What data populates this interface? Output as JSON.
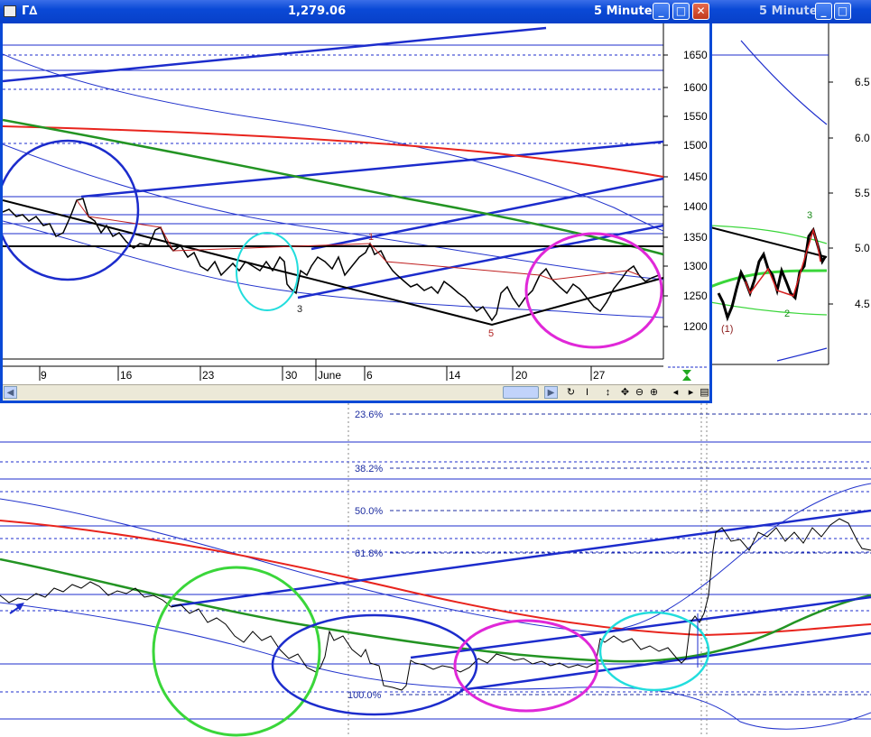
{
  "main_window": {
    "title_left": "Γ∆",
    "title_price": "1,279.06",
    "title_interval": "5 Minute",
    "minimize_label": "_",
    "maximize_label": "□",
    "close_label": "✕"
  },
  "side_window": {
    "title_interval": "5 Minute",
    "minimize_label": "_",
    "maximize_label": "□"
  },
  "chart_data": [
    {
      "type": "line",
      "panel": "main",
      "y_ticks": [
        "1650",
        "1600",
        "1550",
        "1500",
        "1450",
        "1400",
        "1350",
        "1300",
        "1250",
        "1200"
      ],
      "ylim": [
        1150,
        1700
      ],
      "x_ticks": [
        "9",
        "16",
        "23",
        "30",
        "June",
        "6",
        "14",
        "20",
        "27"
      ],
      "wave_labels": [
        "3",
        "1",
        "5"
      ],
      "series": [
        {
          "values": [
            1400,
            1390,
            1375,
            1365,
            1380,
            1410,
            1360,
            1345,
            1330,
            1360,
            1320,
            1300,
            1280,
            1290,
            1300,
            1285,
            1260,
            1300,
            1250,
            1315,
            1290,
            1270,
            1330,
            1350,
            1320,
            1270,
            1250,
            1240,
            1255,
            1230,
            1210,
            1260,
            1290,
            1270,
            1240,
            1260,
            1230,
            1250,
            1290,
            1300,
            1280,
            1279
          ]
        }
      ],
      "annotations": {
        "ellipses": [
          "dark-blue",
          "cyan",
          "magenta"
        ],
        "lines": [
          "red",
          "green",
          "blue-channel",
          "black-trendline",
          "black-horizontal"
        ]
      }
    },
    {
      "type": "line",
      "panel": "side",
      "y_ticks": [
        "6.5",
        "6.0",
        "5.5",
        "5.0",
        "4.5"
      ],
      "ylim": [
        4.0,
        7.0
      ],
      "wave_labels": [
        "3",
        "2",
        "(1)"
      ]
    },
    {
      "type": "line",
      "panel": "bottom",
      "fib_levels": [
        "23.6%",
        "38.2%",
        "50.0%",
        "61.8%",
        "100.0%"
      ],
      "annotations": {
        "ellipses": [
          "green",
          "dark-blue",
          "magenta",
          "cyan"
        ],
        "lines": [
          "red",
          "green",
          "blue-channel"
        ]
      }
    }
  ],
  "colors": {
    "title_bar": "#0a49d6",
    "axis_text": "#000000",
    "red_line": "#e8241d",
    "green_line": "#239423",
    "blue_line": "#1c2ccc",
    "thin_blue": "#2233cc",
    "cyan": "#22dddd",
    "magenta": "#e028d8",
    "bright_green": "#3ad63a",
    "fib_text": "#1c2ca0"
  },
  "icons": [
    "app-icon",
    "minimize-icon",
    "maximize-icon",
    "close-icon",
    "scroll-left-icon",
    "scroll-right-icon",
    "cursor-tool-icon",
    "text-tool-icon",
    "pan-vertical-icon",
    "crosshair-icon",
    "zoom-out-icon",
    "zoom-in-icon",
    "page-left-icon",
    "page-right-icon",
    "list-icon",
    "blue-arrow-icon"
  ]
}
